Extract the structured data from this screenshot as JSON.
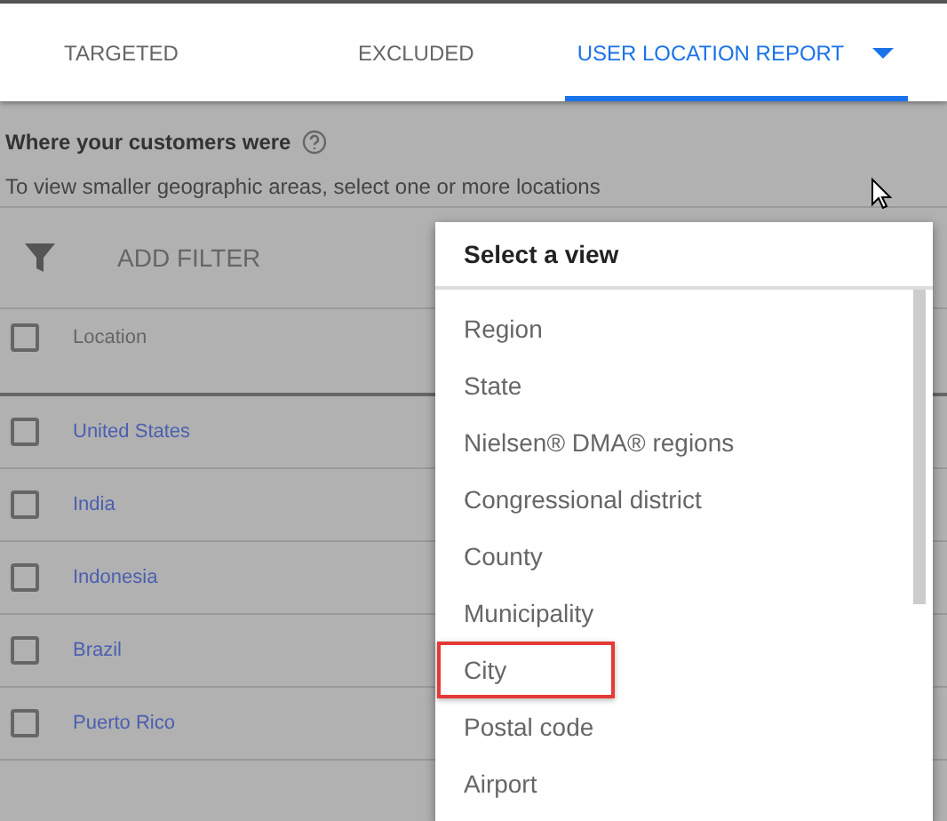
{
  "tabs": [
    {
      "label": "TARGETED",
      "selected": false,
      "has_dropdown": false
    },
    {
      "label": "EXCLUDED",
      "selected": false,
      "has_dropdown": false
    },
    {
      "label": "USER LOCATION REPORT",
      "selected": true,
      "has_dropdown": true
    }
  ],
  "report": {
    "heading": "Where your customers were",
    "hint": "To view smaller geographic areas, select one or more locations"
  },
  "filter": {
    "label": "ADD FILTER"
  },
  "table": {
    "header": {
      "label": "Location",
      "checked": false
    },
    "rows": [
      {
        "location": "United States",
        "checked": false
      },
      {
        "location": "India",
        "checked": false
      },
      {
        "location": "Indonesia",
        "checked": false
      },
      {
        "location": "Brazil",
        "checked": false
      },
      {
        "location": "Puerto Rico",
        "checked": false
      }
    ]
  },
  "view_menu": {
    "title": "Select a view",
    "items": [
      {
        "label": "Region",
        "highlighted": false
      },
      {
        "label": "State",
        "highlighted": false
      },
      {
        "label": "Nielsen® DMA® regions",
        "highlighted": false
      },
      {
        "label": "Congressional district",
        "highlighted": false
      },
      {
        "label": "County",
        "highlighted": false
      },
      {
        "label": "Municipality",
        "highlighted": false
      },
      {
        "label": "City",
        "highlighted": true
      },
      {
        "label": "Postal code",
        "highlighted": false
      },
      {
        "label": "Airport",
        "highlighted": false
      }
    ]
  }
}
